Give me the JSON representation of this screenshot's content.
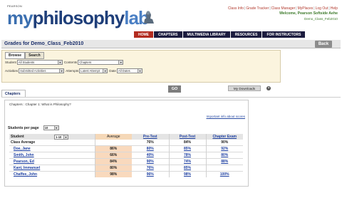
{
  "header": {
    "publisher": "PEARSON",
    "brand_my": "my",
    "brand_phil": "philosophy",
    "brand_lab": "lab",
    "links": [
      "Class Info",
      "Grade Tracker",
      "Class Manager",
      "MyPlaces",
      "Log Out",
      "Help"
    ],
    "welcome": "Welcome, Pearson Softside Aehe",
    "class_name": "Demo_Class_Feb2010",
    "nav": [
      "HOME",
      "CHAPTERS",
      "MULTIMEDIA LIBRARY",
      "RESOURCES",
      "FOR INSTRUCTORS"
    ]
  },
  "title": "Grades for Demo_Class_Feb2010",
  "back_label": "Back",
  "filters": {
    "tabs": [
      "Browse",
      "Search"
    ],
    "student_label": "Student",
    "student_value": "All Students",
    "contents_label": "Contents",
    "contents_value": "Chapters",
    "activities_label": "Activities",
    "activities_value": "Submitted Activities",
    "attempts_label": "Attempts",
    "attempts_value": "Latest Attempt",
    "date_label": "Date",
    "date_value": "All Dates",
    "go_label": "GO",
    "downloads_label": "My Downloads",
    "help_glyph": "?"
  },
  "section_tab": "Chapters",
  "breadcrumb": "Chapters : Chapter 1: What is Philosophy?",
  "info_link": "Important info about scores",
  "per_page_label": "Students per page",
  "per_page_value": "10",
  "table": {
    "student_header": "Student",
    "range_value": "1-10",
    "average_header": "Average",
    "columns": [
      "Pre-Test",
      "Post-Test",
      "Chapter Exam"
    ],
    "class_average_label": "Class Average",
    "class_average": [
      "76%",
      "84%",
      "90%"
    ],
    "rows": [
      {
        "name": "Doe, Jane",
        "avg": "86%",
        "scores": [
          "80%",
          "85%",
          "92%"
        ]
      },
      {
        "name": "Smith, John",
        "avg": "66%",
        "scores": [
          "40%",
          "78%",
          "80%"
        ]
      },
      {
        "name": "Pearson, Ed",
        "avg": "84%",
        "scores": [
          "90%",
          "74%",
          "88%"
        ]
      },
      {
        "name": "Kant, Immanuel",
        "avg": "80%",
        "scores": [
          "76%",
          "85%",
          ""
        ]
      },
      {
        "name": "Chaffee, John",
        "avg": "98%",
        "scores": [
          "96%",
          "98%",
          "100%"
        ]
      }
    ]
  }
}
